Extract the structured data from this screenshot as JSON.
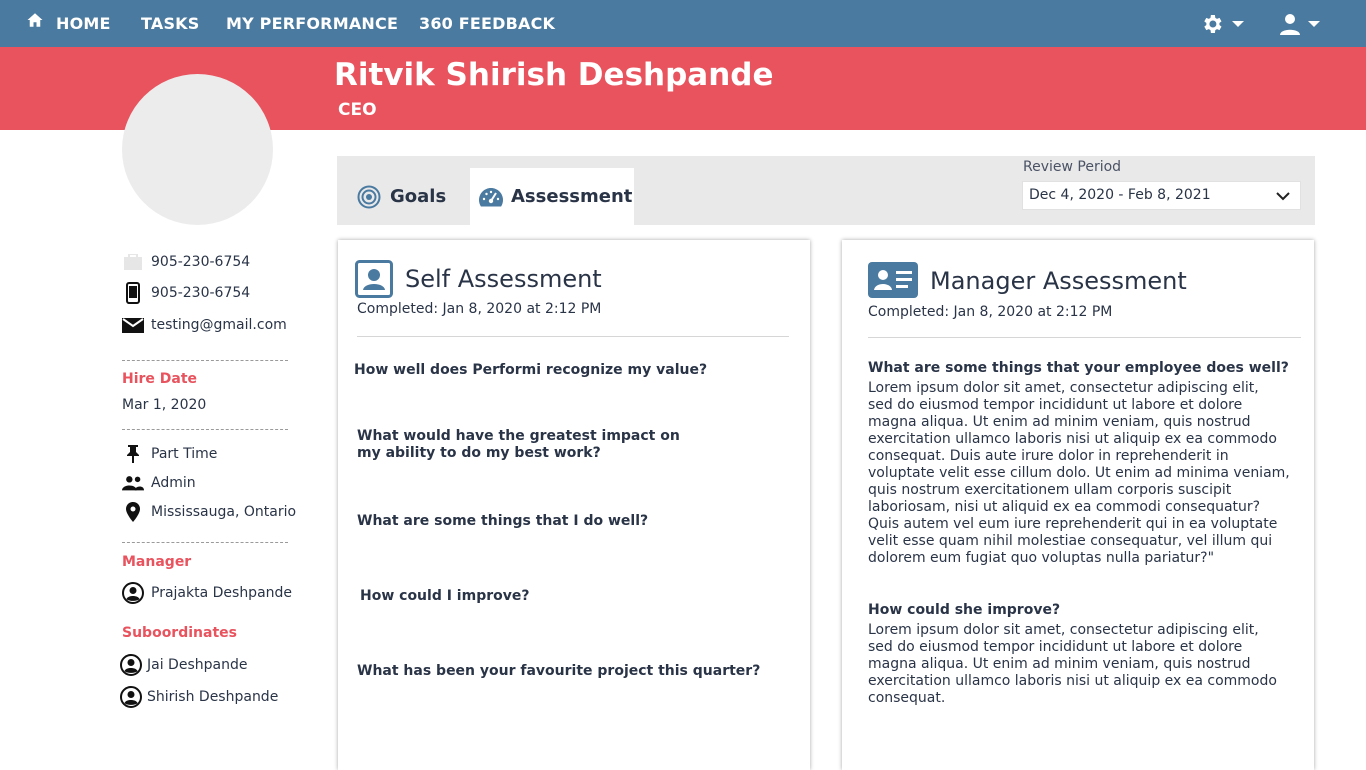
{
  "nav": {
    "home": "HOME",
    "tasks": "TASKS",
    "performance": "MY PERFORMANCE",
    "feedback": "360 FEEDBACK",
    "icons": [
      "home-icon",
      "gear-icon",
      "user-icon"
    ]
  },
  "profile": {
    "name": "Ritvik Shirish Deshpande",
    "title": "CEO",
    "work_phone": "905-230-6754",
    "mobile_phone": "905-230-6754",
    "email": "testing@gmail.com",
    "hire_date_label": "Hire Date",
    "hire_date": "Mar 1, 2020",
    "employment_type": "Part Time",
    "role": "Admin",
    "location": "Mississauga, Ontario",
    "manager_label": "Manager",
    "manager": "Prajakta Deshpande",
    "subordinates_label": "Suboordinates",
    "subordinates": [
      "Jai Deshpande",
      "Shirish Deshpande"
    ]
  },
  "tabs": {
    "goals": "Goals",
    "assessment": "Assessment",
    "active": "assessment"
  },
  "review": {
    "label": "Review Period",
    "value": "Dec 4, 2020 - Feb 8, 2021"
  },
  "self": {
    "title": "Self Assessment",
    "completed": "Completed: Jan 8, 2020 at 2:12 PM",
    "questions": [
      "How well does Performi recognize my value?",
      "What would have the greatest impact on my ability to do my best work?",
      "What are some things that I do well?",
      "How could I improve?",
      "What has been your favourite project this quarter?"
    ]
  },
  "manager": {
    "title": "Manager Assessment",
    "completed": "Completed: Jan 8, 2020 at 2:12 PM",
    "q1": "What are some things that your employee does well?",
    "a1": "Lorem ipsum dolor sit amet, consectetur adipiscing elit,\n sed do eiusmod tempor incididunt ut labore et dolore\n magna aliqua. Ut enim ad minim veniam, quis nostrud\n exercitation ullamco laboris nisi ut aliquip ex ea commodo\n consequat. Duis aute irure dolor in reprehenderit in\nvoluptate velit esse cillum dolo.  Ut enim ad minima veniam,\n quis nostrum exercitationem ullam corporis suscipit\nlaboriosam, nisi ut aliquid ex ea commodi consequatur?\n Quis autem vel eum iure reprehenderit qui in ea voluptate\n velit esse quam nihil molestiae consequatur, vel illum qui\ndolorem eum fugiat quo voluptas nulla pariatur?\"",
    "q2": "How could she improve?",
    "a2": "Lorem ipsum dolor sit amet, consectetur adipiscing elit,\n sed do eiusmod tempor incididunt ut labore et dolore\n magna aliqua. Ut enim ad minim veniam, quis nostrud\n exercitation ullamco laboris nisi ut aliquip ex ea commodo\n consequat."
  },
  "colors": {
    "nav": "#4a7aa0",
    "band": "#e8535e",
    "text": "#2a3447",
    "tabs_bg": "#e9e9ea"
  }
}
